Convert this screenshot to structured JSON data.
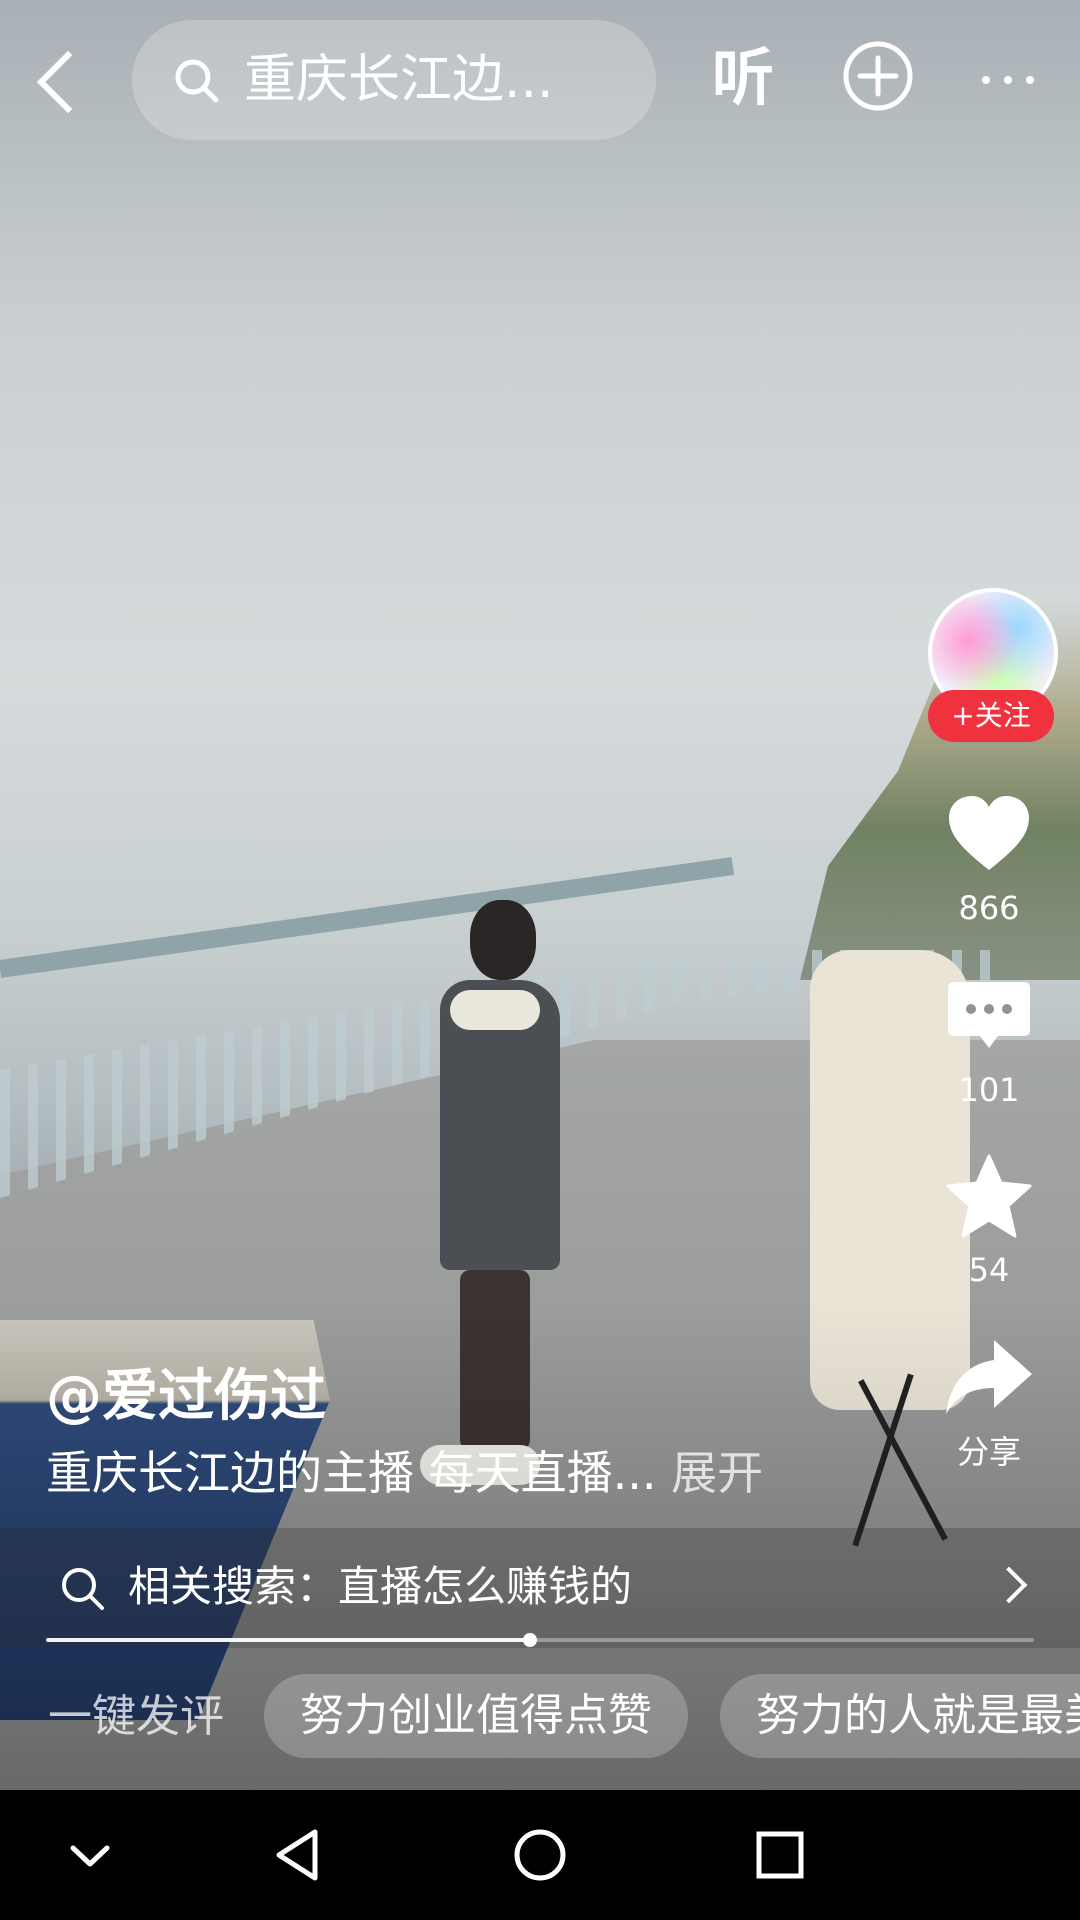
{
  "top_bar": {
    "search_query": "重庆长江边...",
    "listen_label": "听"
  },
  "right_rail": {
    "follow_label": "+关注",
    "likes": "866",
    "comments": "101",
    "favorites": "54",
    "share_label": "分享"
  },
  "post": {
    "author": "@爱过伤过",
    "description": "重庆长江边的主播 每天直播...",
    "expand_label": "展开"
  },
  "related_search": {
    "text": "相关搜索：直播怎么赚钱的"
  },
  "playback": {
    "progress": 0.49
  },
  "quick_comments": {
    "label": "一键发评",
    "chips": [
      "努力创业值得点赞",
      "努力的人就是最美"
    ]
  },
  "colors": {
    "follow_red": "#f0323f"
  }
}
